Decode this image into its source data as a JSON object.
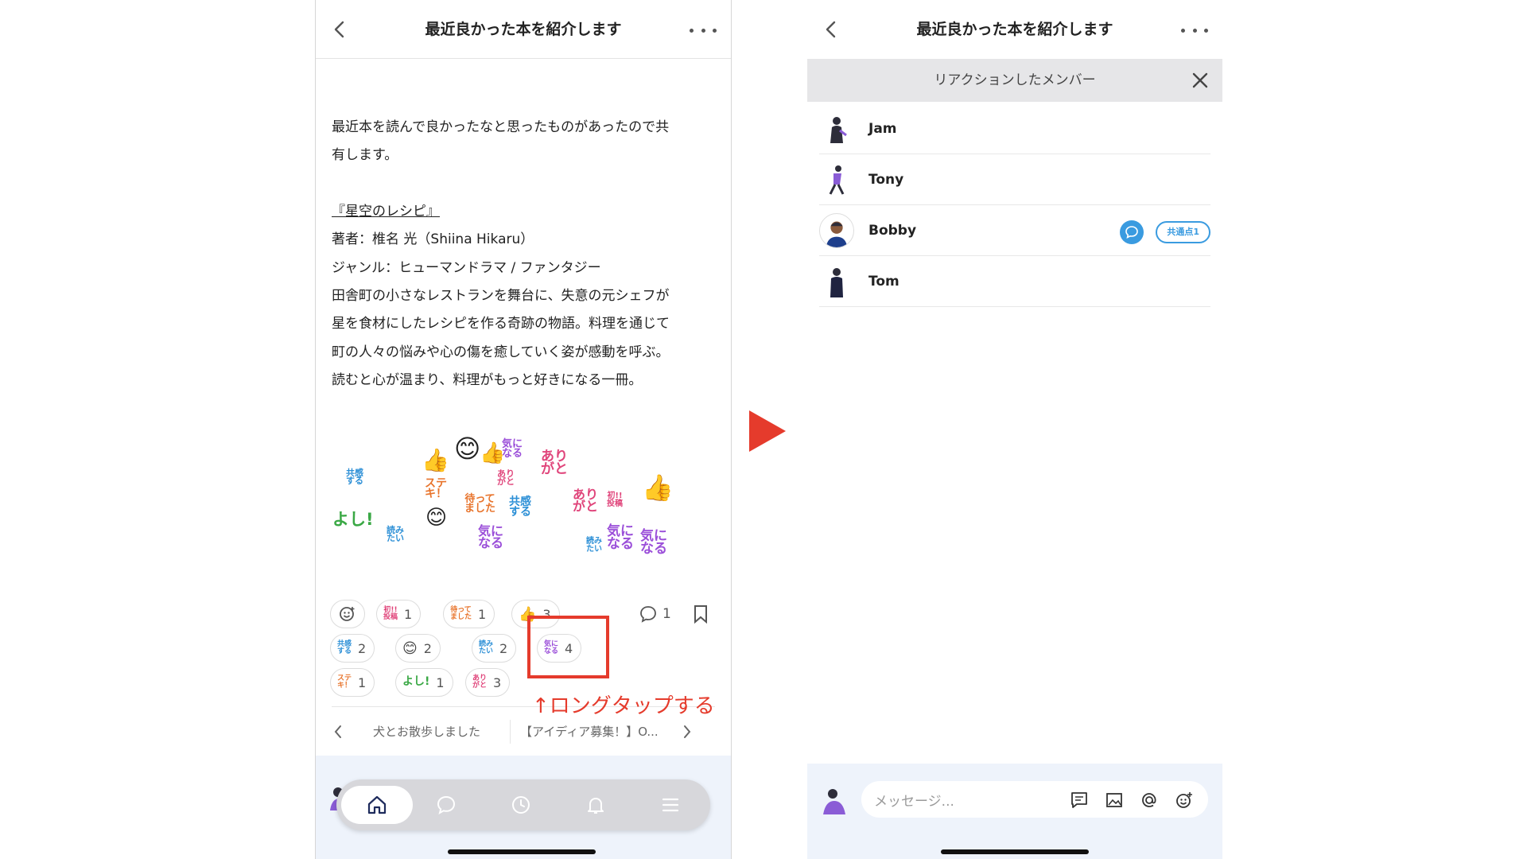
{
  "left_screen": {
    "title": "最近良かった本を紹介します",
    "body": {
      "intro_line1": "最近本を読んで良かったなと思ったものがあったので共",
      "intro_line2": "有します。",
      "book_title": "『星空のレシピ』",
      "author": "著者：椎名 光（Shiina Hikaru）",
      "genre": "ジャンル：ヒューマンドラマ / ファンタジー",
      "desc_line1": "田舎町の小さなレストランを舞台に、失意の元シェフが",
      "desc_line2": "星を食材にしたレシピを作る奇跡の物語。料理を通じて",
      "desc_line3": "町の人々の悩みや心の傷を癒していく姿が感動を呼ぶ。",
      "desc_line4": "読むと心が温まり、料理がもっと好きになる一冊。"
    },
    "stickers": {
      "kyokan": "共感\nする",
      "yoshi": "よし!",
      "yomitai": "読み\nたい",
      "suteki": "ステ\nキ！",
      "matte": "待って\nました",
      "kininaru": "気に\nなる",
      "arigato": "あり\nがと",
      "hatsu": "初!!\n投稿"
    },
    "reactions": [
      {
        "label": "初!!\n投稿",
        "count": "1",
        "color": "#e0457b"
      },
      {
        "label": "待って\nました",
        "count": "1",
        "color": "#e8742c"
      },
      {
        "label": "👍",
        "count": "3",
        "color": "#f2b400"
      },
      {
        "label": "共感\nする",
        "count": "2",
        "color": "#2c8fd6"
      },
      {
        "label": "😊",
        "count": "2",
        "color": "#f2b400"
      },
      {
        "label": "読み\nたい",
        "count": "2",
        "color": "#2c8fd6"
      },
      {
        "label": "気に\nなる",
        "count": "4",
        "color": "#9b4fd9"
      },
      {
        "label": "ステ\nキ！",
        "count": "1",
        "color": "#e8742c"
      },
      {
        "label": "よし!",
        "count": "1",
        "color": "#3aa845"
      },
      {
        "label": "あり\nがと",
        "count": "3",
        "color": "#e0457b"
      }
    ],
    "comment_count": "1",
    "callout": "↑ロングタップする",
    "prev_post": "犬とお散歩しました",
    "next_post": "【アイディア募集！】O...",
    "tabs": [
      "home-icon",
      "chat-icon",
      "clock-icon",
      "bell-icon",
      "menu-icon"
    ]
  },
  "right_screen": {
    "title": "最近良かった本を紹介します",
    "subheader": "リアクションしたメンバー",
    "members": [
      {
        "name": "Jam"
      },
      {
        "name": "Tony"
      },
      {
        "name": "Bobby",
        "common_badge": "共通点1"
      },
      {
        "name": "Tom"
      }
    ],
    "message_placeholder": "メッセージ..."
  },
  "colors": {
    "accent_red": "#e53b2c",
    "blue": "#3a9be0",
    "purple": "#9b4fd9",
    "pink": "#e0457b",
    "orange": "#e8742c",
    "green": "#3aa845"
  }
}
